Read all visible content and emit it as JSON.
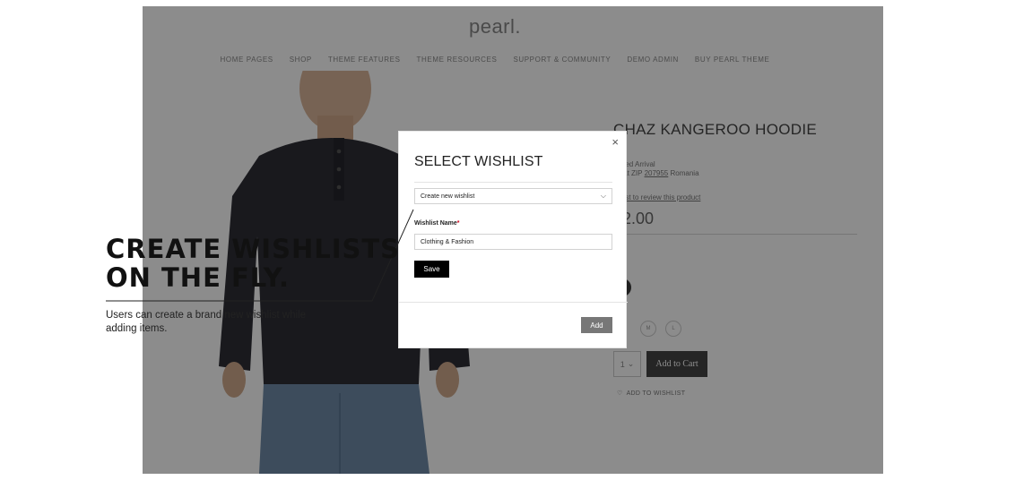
{
  "site": {
    "logo": "pearl.",
    "nav": [
      "HOME PAGES",
      "SHOP",
      "THEME FEATURES",
      "THEME RESOURCES",
      "SUPPORT & COMMUNITY",
      "DEMO ADMIN",
      "BUY PEARL THEME"
    ]
  },
  "product": {
    "title": "CHAZ KANGEROO HOODIE",
    "arrival_label": "mated Arrival",
    "ship_text": "ne at ZIP",
    "zip": "207955",
    "country": "Romania",
    "review_link": "e first to review this product",
    "price": "52.00",
    "sizes": [
      "M",
      "L"
    ],
    "qty": "1",
    "add_to_cart": "Add to Cart",
    "add_to_wishlist": "ADD TO WISHLIST"
  },
  "modal": {
    "title": "SELECT WISHLIST",
    "close_symbol": "×",
    "select_value": "Create new wishlist",
    "name_label": "Wishlist Name",
    "required_mark": "*",
    "name_value": "Clothing & Fashion",
    "save_label": "Save",
    "add_label": "Add"
  },
  "callout": {
    "heading_line1": "CREATE WISHLISTS",
    "heading_line2": "ON THE FLY.",
    "text": "Users can create a brand new wishlist while adding items."
  },
  "colors": {
    "overlay": "rgba(0,0,0,0.45)",
    "save_button": "#000000",
    "add_button": "#777777",
    "required": "#d0021b"
  }
}
